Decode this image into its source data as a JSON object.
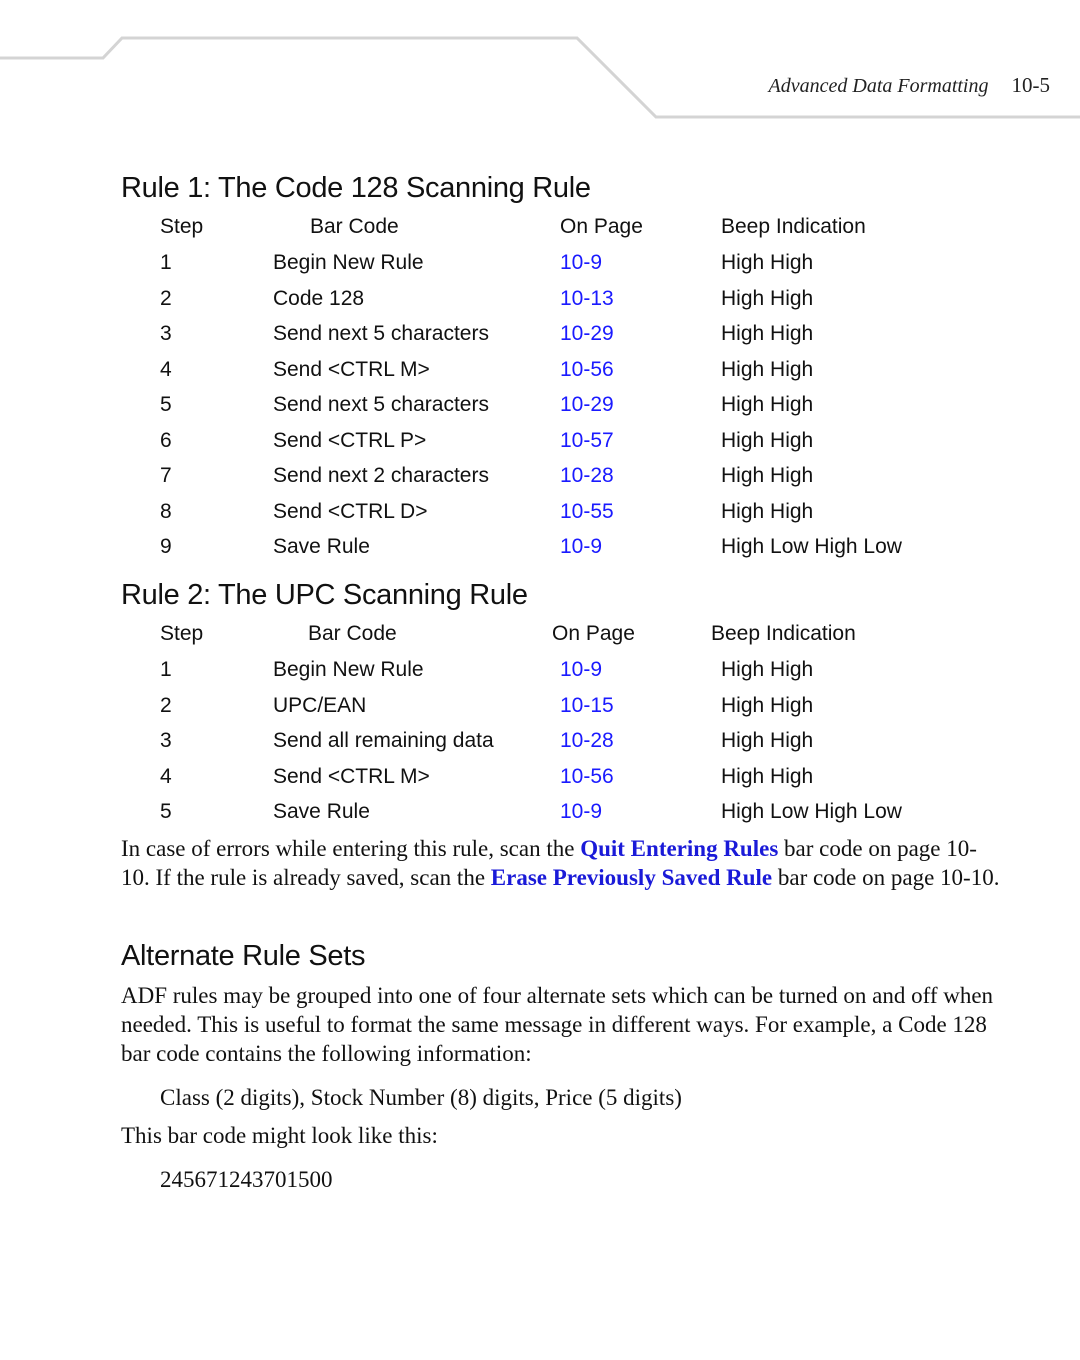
{
  "header": {
    "section_title": "Advanced Data Formatting",
    "page_number": "10-5",
    "rule_color": "#d4d4d4"
  },
  "rule1": {
    "heading": "Rule 1: The Code 128 Scanning Rule",
    "columns": [
      "Step",
      "Bar Code",
      "On Page",
      "Beep Indication"
    ],
    "rows": [
      {
        "step": "1",
        "barcode": "Begin New Rule",
        "page": "10-9",
        "beep": "High High"
      },
      {
        "step": "2",
        "barcode": "Code 128",
        "page": "10-13",
        "beep": "High High"
      },
      {
        "step": "3",
        "barcode": "Send next 5 characters",
        "page": "10-29",
        "beep": "High High"
      },
      {
        "step": "4",
        "barcode": "Send <CTRL M>",
        "page": "10-56",
        "beep": "High High"
      },
      {
        "step": "5",
        "barcode": "Send next 5 characters",
        "page": "10-29",
        "beep": "High High"
      },
      {
        "step": "6",
        "barcode": "Send <CTRL P>",
        "page": "10-57",
        "beep": "High High"
      },
      {
        "step": "7",
        "barcode": "Send next 2 characters",
        "page": "10-28",
        "beep": "High High"
      },
      {
        "step": "8",
        "barcode": "Send <CTRL D>",
        "page": "10-55",
        "beep": "High High"
      },
      {
        "step": "9",
        "barcode": "Save Rule",
        "page": "10-9",
        "beep": "High Low High Low"
      }
    ]
  },
  "rule2": {
    "heading": "Rule 2: The UPC Scanning Rule",
    "columns": [
      "Step",
      "Bar Code",
      "On Page",
      "Beep Indication"
    ],
    "rows": [
      {
        "step": "1",
        "barcode": "Begin New Rule",
        "page": "10-9",
        "beep": "High High"
      },
      {
        "step": "2",
        "barcode": "UPC/EAN",
        "page": "10-15",
        "beep": "High High"
      },
      {
        "step": "3",
        "barcode": "Send all remaining data",
        "page": "10-28",
        "beep": "High High"
      },
      {
        "step": "4",
        "barcode": "Send <CTRL M>",
        "page": "10-56",
        "beep": "High High"
      },
      {
        "step": "5",
        "barcode": "Save Rule",
        "page": "10-9",
        "beep": "High Low High Low"
      }
    ]
  },
  "errors_paragraph": {
    "part1": "In case of errors while entering this rule, scan the ",
    "link1": "Quit Entering Rules",
    "part2": " bar code on page 10-10. If the rule is already saved, scan the ",
    "link2": "Erase Previously Saved Rule",
    "part3": " bar code on page 10-10."
  },
  "alternate": {
    "heading": "Alternate Rule Sets",
    "paragraph": "ADF rules may be grouped into one of four alternate sets which can be turned on and off when needed. This is useful to format the same message in different ways. For example, a Code 128 bar code contains the following information:",
    "fields_line": "Class (2 digits), Stock Number (8) digits, Price (5 digits)",
    "example_intro": "This bar code might look like this:",
    "example_value": "245671243701500"
  },
  "colors": {
    "link": "#1a1aff",
    "text": "#111111"
  }
}
